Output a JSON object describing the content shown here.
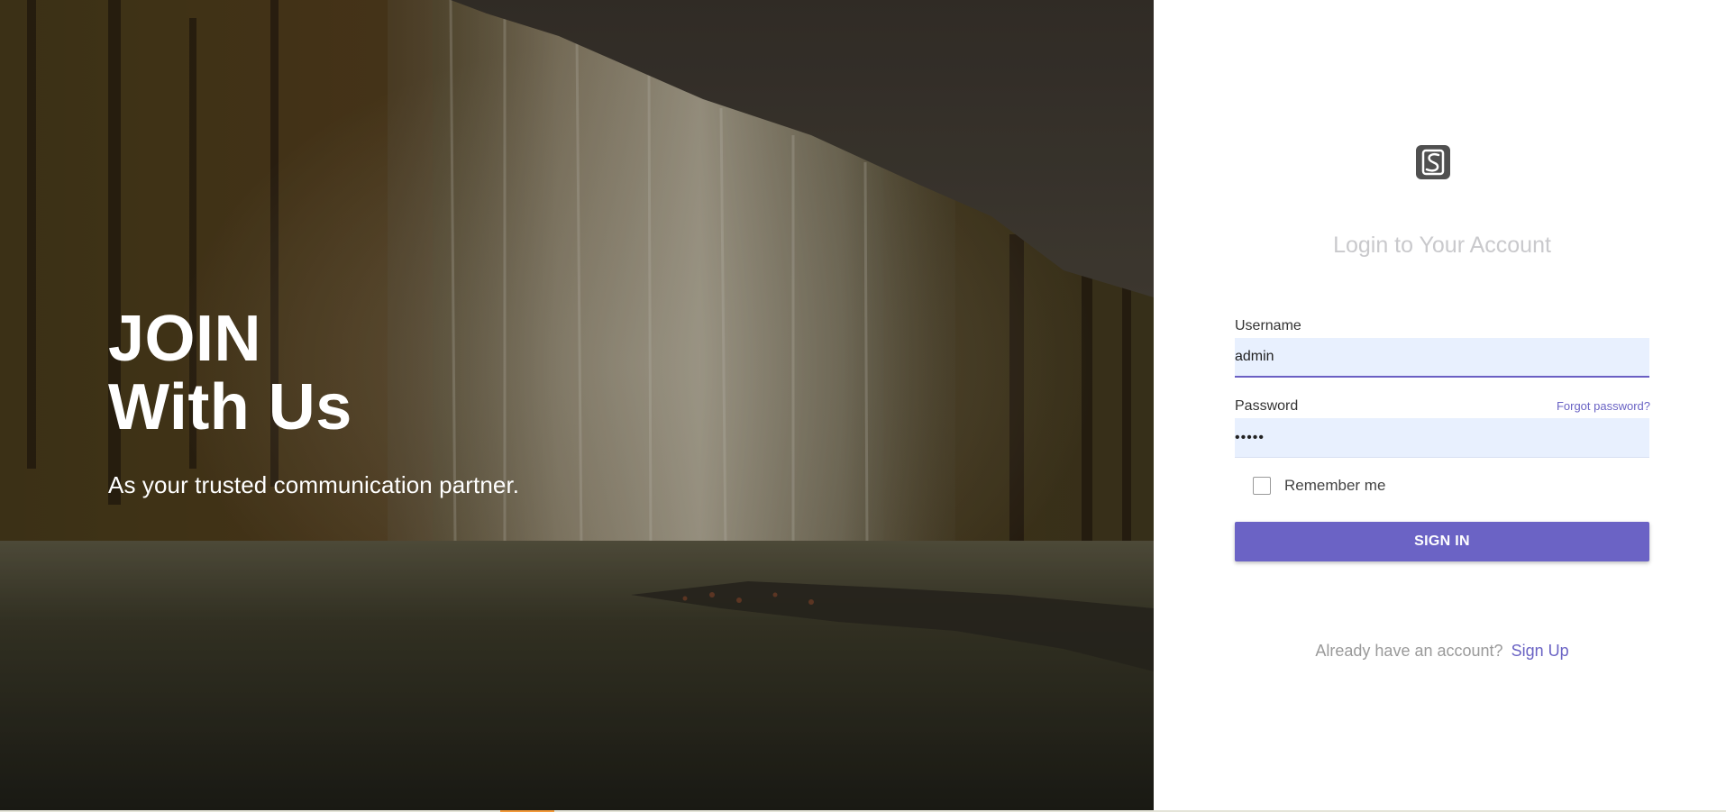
{
  "hero": {
    "title_line1": "JOIN",
    "title_line2": "With Us",
    "subtitle": "As your trusted communication partner.",
    "image_description": "waterfall-under-rock-overhang-in-autumn-forest"
  },
  "login": {
    "logo_icon": "brand-logo-icon",
    "title": "Login to Your Account",
    "username": {
      "label": "Username",
      "value": "admin"
    },
    "password": {
      "label": "Password",
      "value": "•••••",
      "forgot_label": "Forgot password?"
    },
    "remember_me": {
      "label": "Remember me",
      "checked": false
    },
    "signin_label": "SIGN IN",
    "signup_prompt": "Already have an account?",
    "signup_link": "Sign Up"
  },
  "colors": {
    "accent": "#6b63c5",
    "input_background": "#e8f0fe",
    "title_muted": "#c9c9cc"
  }
}
